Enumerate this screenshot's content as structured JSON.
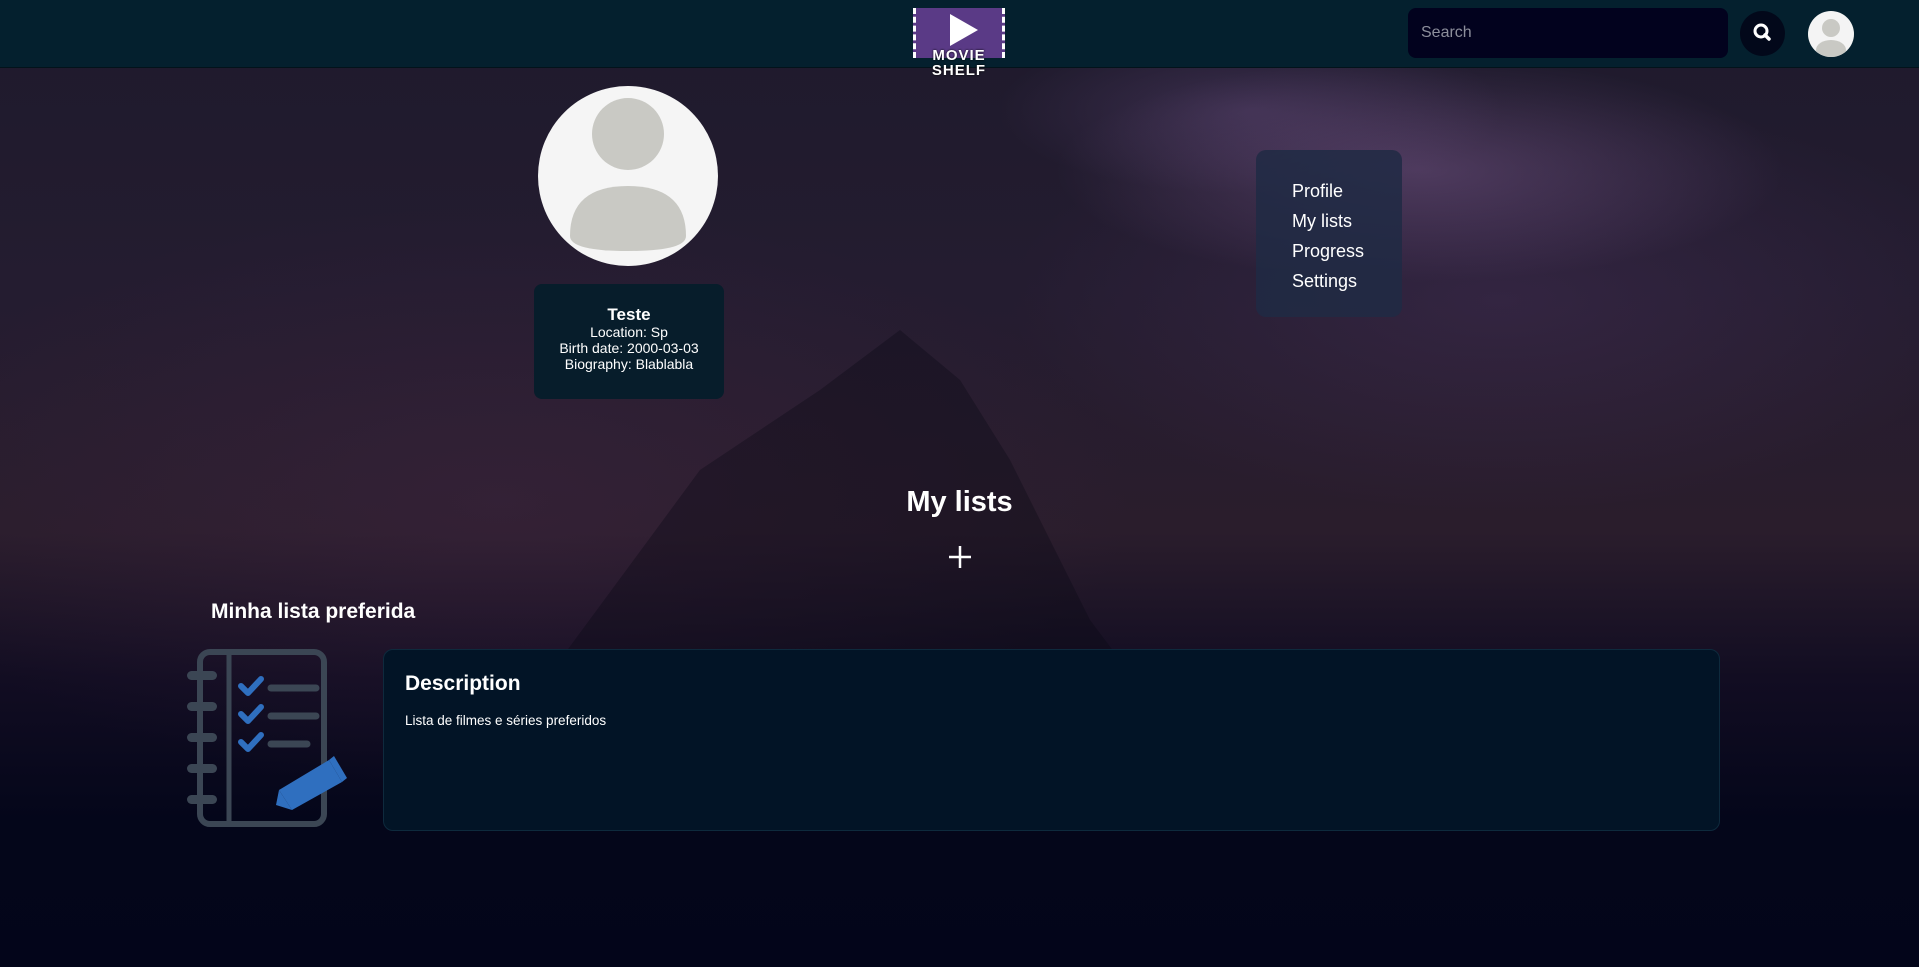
{
  "header": {
    "logo": {
      "line1": "MOVIE",
      "line2": "SHELF"
    },
    "search": {
      "placeholder": "Search",
      "value": ""
    },
    "icons": {
      "search": "search-icon",
      "avatar": "user-avatar-icon"
    }
  },
  "profile": {
    "name": "Teste",
    "location": "Location: Sp",
    "birth_date": "Birth date: 2000-03-03",
    "biography": "Biography: Blablabla"
  },
  "menu": {
    "items": [
      {
        "label": "Profile"
      },
      {
        "label": "My lists"
      },
      {
        "label": "Progress"
      },
      {
        "label": "Settings"
      }
    ]
  },
  "lists_section": {
    "title": "My lists",
    "add_icon": "plus-icon",
    "lists": [
      {
        "name": "Minha lista preferida",
        "icon": "checklist-notebook-icon",
        "description_label": "Description",
        "description": "Lista de filmes e séries preferidos"
      }
    ]
  },
  "colors": {
    "header_bg": "#04202e",
    "logo_bg": "#5a3a86",
    "card_bg": "#071d2b",
    "accent_blue": "#2f6fbf",
    "notebook_gray": "#3b4654"
  }
}
